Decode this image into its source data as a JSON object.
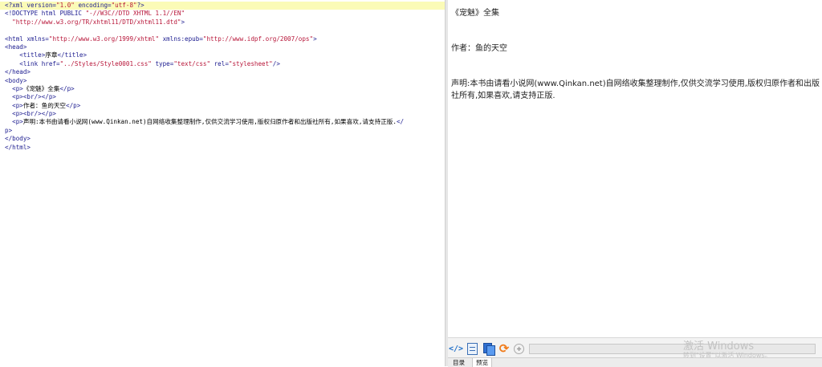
{
  "editor": {
    "lines": [
      "<?xml version=\"1.0\" encoding=\"utf-8\"?>",
      "<!DOCTYPE html PUBLIC \"-//W3C//DTD XHTML 1.1//EN\"",
      "  \"http://www.w3.org/TR/xhtml11/DTD/xhtml11.dtd\">",
      "",
      "<html xmlns=\"http://www.w3.org/1999/xhtml\" xmlns:epub=\"http://www.idpf.org/2007/ops\">",
      "<head>",
      "    <title>序章</title>",
      "    <link href=\"../Styles/Style0001.css\" type=\"text/css\" rel=\"stylesheet\"/>",
      "</head>",
      "<body>",
      "  <p>《宠魅》全集</p>",
      "  <p><br/></p>",
      "  <p>作者：鱼的天空</p>",
      "  <p><br/></p>",
      "  <p>声明:本书由请看小说网(www.Qinkan.net)自网络收集整理制作,仅供交流学习使用,版权归原作者和出版社所有,如果喜欢,请支持正版.</",
      "p>",
      "</body>",
      "</html>"
    ]
  },
  "preview": {
    "title": "《宠魅》全集",
    "author": "作者：鱼的天空",
    "statement": "声明:本书由请看小说网(www.Qinkan.net)自网络收集整理制作,仅供交流学习使用,版权归原作者和出版社所有,如果喜欢,请支持正版."
  },
  "toolbar": {
    "icons": [
      "code-view-icon",
      "document-icon",
      "copy-icon",
      "refresh-icon",
      "zoom-icon"
    ],
    "code_glyph": "</>",
    "refresh_glyph": "⟳",
    "zoom_glyph": "✚",
    "accent_color": "#f07a18"
  },
  "watermark": {
    "line1": "激活 Windows",
    "line2": "转到\"设置\"以激活 Windows。"
  },
  "tabs": [
    {
      "label": "目录"
    },
    {
      "label": "预览"
    }
  ]
}
